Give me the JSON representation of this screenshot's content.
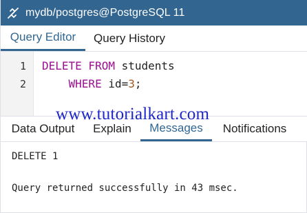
{
  "connection": {
    "title": "mydb/postgres@PostgreSQL 11",
    "icon": "sync-icon",
    "bar_color": "#326690"
  },
  "editor_tabs": [
    {
      "label": "Query Editor",
      "active": true
    },
    {
      "label": "Query History",
      "active": false
    }
  ],
  "editor": {
    "line_numbers": [
      "1",
      "2"
    ],
    "lines": [
      [
        {
          "text": "DELETE FROM",
          "type": "keyword"
        },
        {
          "text": " students",
          "type": "plain"
        }
      ],
      [
        {
          "text": "    ",
          "type": "plain"
        },
        {
          "text": "WHERE",
          "type": "keyword"
        },
        {
          "text": " id=",
          "type": "plain"
        },
        {
          "text": "3",
          "type": "number"
        },
        {
          "text": ";",
          "type": "plain"
        }
      ]
    ]
  },
  "watermark": "www.tutorialkart.com",
  "result_tabs": [
    {
      "label": "Data Output",
      "active": false
    },
    {
      "label": "Explain",
      "active": false
    },
    {
      "label": "Messages",
      "active": true
    },
    {
      "label": "Notifications",
      "active": false
    }
  ],
  "messages": {
    "line1": "DELETE 1",
    "line2": "Query returned successfully in 43 msec."
  }
}
